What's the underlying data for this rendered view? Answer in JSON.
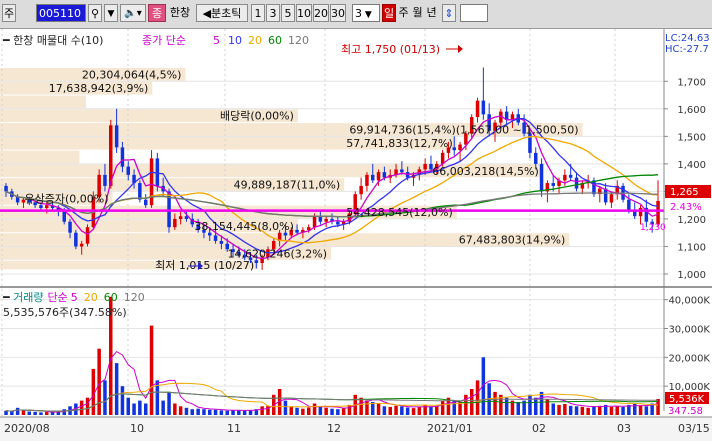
{
  "toolbar": {
    "left_label": "주",
    "stock_code": "005110",
    "stock_name": "한창",
    "tick_label": "분초틱",
    "intervals": [
      "1",
      "3",
      "5",
      "10",
      "20",
      "30"
    ],
    "interval_value": "3",
    "period_buttons": [
      "일",
      "주",
      "월",
      "년"
    ],
    "colors": {
      "bg": "#dcdcdc",
      "code_bg": "#1a1ad6",
      "active_period": "#d00000"
    }
  },
  "price_panel": {
    "title_name": "한창 매물대 수(10)",
    "ma_label": "종가 단순",
    "ma_periods": [
      "5",
      "10",
      "20",
      "60",
      "120"
    ],
    "ma_colors": [
      "#cc00cc",
      "#3333ee",
      "#f0a800",
      "#008800",
      "#777777"
    ],
    "lc_label": "LC:24.63",
    "hc_label": "HC:-27.7",
    "y_ticks": [
      1000,
      1100,
      1200,
      1300,
      1400,
      1500,
      1600,
      1700
    ],
    "y_tick_labels": [
      "1,000",
      "1,100",
      "1,200",
      "1,300",
      "1,400",
      "1,500",
      "1,600",
      "1,700"
    ],
    "ylim": [
      960,
      1810
    ],
    "current_price_label": "1,265",
    "current_pct_label": "2.43%",
    "mark_price_label": "1,230",
    "hline_price": 1230,
    "hline_color": "#ee00ee",
    "volume_profile": [
      {
        "price_lo": 1015,
        "price_hi": 1050,
        "length": 0.39,
        "label": "최저 1,015 (10/27)"
      },
      {
        "price_lo": 1050,
        "price_hi": 1100,
        "length": 0.5,
        "label": "14,620,246(3,2%)"
      },
      {
        "price_lo": 1100,
        "price_hi": 1150,
        "length": 0.86,
        "label": "67,483,803(14,9%)"
      },
      {
        "price_lo": 1150,
        "price_hi": 1200,
        "length": 0.45,
        "label": "38,154,445(8,0%)"
      },
      {
        "price_lo": 1200,
        "price_hi": 1250,
        "length": 0.69,
        "label": "54,428,545(12,0%)"
      },
      {
        "price_lo": 1250,
        "price_hi": 1300,
        "length": 0.17,
        "label": "유상증자(0,00%)"
      },
      {
        "price_lo": 1300,
        "price_hi": 1350,
        "length": 0.52,
        "label": "49,889,187(11,0%)"
      },
      {
        "price_lo": 1350,
        "price_hi": 1400,
        "length": 0.82,
        "label": "66,003,218(14,5%)"
      },
      {
        "price_lo": 1400,
        "price_hi": 1450,
        "length": 0.12,
        "label": ""
      },
      {
        "price_lo": 1450,
        "price_hi": 1500,
        "length": 0.69,
        "label": "57,741,833(12,7%)"
      },
      {
        "price_lo": 1500,
        "price_hi": 1550,
        "length": 0.88,
        "label": "69,914,736(15,4%)(1,567,00 ~ 1,500,50)"
      },
      {
        "price_lo": 1550,
        "price_hi": 1600,
        "length": 0.45,
        "label": "배당락(0,00%)"
      },
      {
        "price_lo": 1600,
        "price_hi": 1650,
        "length": 0.13,
        "label": ""
      },
      {
        "price_lo": 1650,
        "price_hi": 1700,
        "length": 0.23,
        "label": "17,638,942(3,9%)"
      },
      {
        "price_lo": 1700,
        "price_hi": 1750,
        "length": 0.28,
        "label": "20,304,064(4,5%)"
      }
    ],
    "annotations": {
      "high": "최고 1,750 (01/13)",
      "low": "최저 1,015 (10/27)",
      "rights_issue": "유상증자(0,00%)",
      "ex_dividend": "배당락(0,00%)"
    }
  },
  "volume_panel": {
    "title_prefix": "거래량",
    "ma_label": "단순",
    "ma_periods": [
      "5",
      "20",
      "60",
      "120"
    ],
    "ma_colors": [
      "#cc00cc",
      "#f0a800",
      "#008800",
      "#777777"
    ],
    "value_label": "5,535,576주(347.58%)",
    "y_ticks": [
      10000,
      20000,
      30000,
      40000
    ],
    "y_tick_labels": [
      "10,000K",
      "20,000K",
      "30,000K",
      "40,000K"
    ],
    "ylim": [
      0,
      43000
    ],
    "current_volume_label": "5,536K",
    "current_sub_label": "347.58"
  },
  "x_axis": {
    "tick_labels": [
      "2020/08",
      "10",
      "11",
      "12",
      "2021/01",
      "02",
      "03",
      "03/15"
    ]
  },
  "chart_data": {
    "type": "candlestick",
    "title": "한창 매물대 수(10)",
    "x": [
      "2020/08",
      "10",
      "11",
      "12",
      "2021/01",
      "02",
      "03",
      "03/15"
    ],
    "ylim": [
      960,
      1810
    ],
    "volume_ylim": [
      0,
      43000
    ],
    "candles": [
      [
        1320,
        1330,
        1280,
        1300,
        1500
      ],
      [
        1300,
        1310,
        1270,
        1280,
        1200
      ],
      [
        1280,
        1290,
        1250,
        1260,
        2500
      ],
      [
        1260,
        1280,
        1240,
        1270,
        1800
      ],
      [
        1270,
        1280,
        1250,
        1260,
        1200
      ],
      [
        1260,
        1270,
        1240,
        1250,
        1100
      ],
      [
        1250,
        1260,
        1230,
        1240,
        900
      ],
      [
        1240,
        1260,
        1220,
        1250,
        1000
      ],
      [
        1250,
        1260,
        1230,
        1240,
        900
      ],
      [
        1240,
        1250,
        1210,
        1230,
        1300
      ],
      [
        1230,
        1240,
        1180,
        1190,
        2000
      ],
      [
        1190,
        1200,
        1130,
        1150,
        3000
      ],
      [
        1150,
        1160,
        1090,
        1100,
        4000
      ],
      [
        1100,
        1120,
        1070,
        1110,
        5000
      ],
      [
        1110,
        1180,
        1100,
        1170,
        6000
      ],
      [
        1170,
        1300,
        1160,
        1280,
        16000
      ],
      [
        1280,
        1380,
        1260,
        1360,
        23000
      ],
      [
        1360,
        1400,
        1300,
        1320,
        12000
      ],
      [
        1320,
        1560,
        1310,
        1540,
        41000
      ],
      [
        1540,
        1600,
        1440,
        1460,
        18000
      ],
      [
        1460,
        1480,
        1370,
        1390,
        10000
      ],
      [
        1390,
        1410,
        1340,
        1360,
        6000
      ],
      [
        1360,
        1380,
        1310,
        1330,
        4000
      ],
      [
        1330,
        1340,
        1260,
        1270,
        5000
      ],
      [
        1270,
        1290,
        1240,
        1250,
        4000
      ],
      [
        1250,
        1450,
        1240,
        1420,
        31000
      ],
      [
        1420,
        1440,
        1300,
        1320,
        12000
      ],
      [
        1320,
        1350,
        1280,
        1300,
        5000
      ],
      [
        1300,
        1310,
        1150,
        1170,
        8000
      ],
      [
        1170,
        1220,
        1160,
        1200,
        4000
      ],
      [
        1200,
        1230,
        1180,
        1210,
        3000
      ],
      [
        1210,
        1230,
        1190,
        1200,
        2500
      ],
      [
        1200,
        1220,
        1170,
        1180,
        2000
      ],
      [
        1180,
        1200,
        1150,
        1160,
        2200
      ],
      [
        1160,
        1180,
        1130,
        1150,
        2000
      ],
      [
        1150,
        1170,
        1120,
        1140,
        1800
      ],
      [
        1140,
        1160,
        1110,
        1120,
        1800
      ],
      [
        1120,
        1140,
        1090,
        1110,
        1600
      ],
      [
        1110,
        1130,
        1080,
        1090,
        1500
      ],
      [
        1090,
        1110,
        1060,
        1080,
        1700
      ],
      [
        1080,
        1100,
        1060,
        1070,
        1600
      ],
      [
        1070,
        1090,
        1050,
        1060,
        1500
      ],
      [
        1060,
        1080,
        1040,
        1050,
        1700
      ],
      [
        1050,
        1070,
        1020,
        1040,
        2000
      ],
      [
        1040,
        1070,
        1015,
        1060,
        3000
      ],
      [
        1060,
        1100,
        1050,
        1090,
        3200
      ],
      [
        1090,
        1130,
        1080,
        1120,
        7000
      ],
      [
        1120,
        1160,
        1100,
        1150,
        9000
      ],
      [
        1150,
        1180,
        1120,
        1140,
        5000
      ],
      [
        1140,
        1170,
        1130,
        1160,
        3000
      ],
      [
        1160,
        1180,
        1140,
        1150,
        2500
      ],
      [
        1150,
        1170,
        1130,
        1160,
        2200
      ],
      [
        1160,
        1180,
        1150,
        1170,
        2600
      ],
      [
        1170,
        1220,
        1160,
        1210,
        4000
      ],
      [
        1210,
        1230,
        1180,
        1190,
        3000
      ],
      [
        1190,
        1210,
        1170,
        1200,
        2500
      ],
      [
        1200,
        1220,
        1180,
        1190,
        2200
      ],
      [
        1190,
        1210,
        1170,
        1180,
        2000
      ],
      [
        1180,
        1200,
        1160,
        1190,
        2300
      ],
      [
        1190,
        1230,
        1180,
        1220,
        3500
      ],
      [
        1220,
        1300,
        1210,
        1290,
        7000
      ],
      [
        1290,
        1350,
        1270,
        1320,
        6000
      ],
      [
        1320,
        1370,
        1300,
        1360,
        5000
      ],
      [
        1360,
        1400,
        1330,
        1340,
        4500
      ],
      [
        1340,
        1380,
        1320,
        1370,
        4000
      ],
      [
        1370,
        1390,
        1340,
        1350,
        3000
      ],
      [
        1350,
        1380,
        1330,
        1360,
        2800
      ],
      [
        1360,
        1400,
        1350,
        1380,
        3200
      ],
      [
        1380,
        1410,
        1360,
        1370,
        3000
      ],
      [
        1370,
        1390,
        1340,
        1350,
        2600
      ],
      [
        1350,
        1370,
        1320,
        1360,
        2400
      ],
      [
        1360,
        1390,
        1340,
        1380,
        2800
      ],
      [
        1380,
        1420,
        1360,
        1400,
        3500
      ],
      [
        1400,
        1430,
        1370,
        1380,
        3000
      ],
      [
        1380,
        1410,
        1360,
        1400,
        3200
      ],
      [
        1400,
        1450,
        1390,
        1440,
        5000
      ],
      [
        1440,
        1480,
        1420,
        1460,
        6000
      ],
      [
        1460,
        1500,
        1430,
        1450,
        5000
      ],
      [
        1450,
        1480,
        1410,
        1470,
        4500
      ],
      [
        1470,
        1520,
        1450,
        1510,
        7000
      ],
      [
        1510,
        1580,
        1490,
        1570,
        9000
      ],
      [
        1570,
        1640,
        1550,
        1630,
        12000
      ],
      [
        1630,
        1750,
        1560,
        1580,
        20000
      ],
      [
        1580,
        1620,
        1500,
        1520,
        11000
      ],
      [
        1520,
        1560,
        1480,
        1550,
        8000
      ],
      [
        1550,
        1600,
        1530,
        1590,
        7000
      ],
      [
        1590,
        1610,
        1540,
        1560,
        6000
      ],
      [
        1560,
        1590,
        1530,
        1580,
        5000
      ],
      [
        1580,
        1600,
        1540,
        1550,
        4500
      ],
      [
        1550,
        1580,
        1500,
        1510,
        5000
      ],
      [
        1510,
        1530,
        1420,
        1440,
        7000
      ],
      [
        1440,
        1460,
        1380,
        1400,
        6000
      ],
      [
        1400,
        1420,
        1280,
        1300,
        8000
      ],
      [
        1300,
        1340,
        1260,
        1330,
        5500
      ],
      [
        1330,
        1360,
        1300,
        1320,
        4000
      ],
      [
        1320,
        1350,
        1290,
        1340,
        3500
      ],
      [
        1340,
        1380,
        1320,
        1360,
        3800
      ],
      [
        1360,
        1400,
        1340,
        1350,
        3200
      ],
      [
        1350,
        1370,
        1300,
        1310,
        3000
      ],
      [
        1310,
        1340,
        1290,
        1330,
        2800
      ],
      [
        1330,
        1360,
        1310,
        1340,
        2500
      ],
      [
        1340,
        1350,
        1280,
        1290,
        3000
      ],
      [
        1290,
        1320,
        1260,
        1310,
        3200
      ],
      [
        1310,
        1330,
        1250,
        1260,
        3500
      ],
      [
        1260,
        1300,
        1240,
        1290,
        2800
      ],
      [
        1290,
        1340,
        1270,
        1320,
        3000
      ],
      [
        1320,
        1330,
        1260,
        1270,
        2800
      ],
      [
        1270,
        1290,
        1220,
        1230,
        3500
      ],
      [
        1230,
        1260,
        1200,
        1210,
        3800
      ],
      [
        1210,
        1250,
        1180,
        1240,
        3200
      ],
      [
        1240,
        1270,
        1170,
        1190,
        3000
      ],
      [
        1190,
        1200,
        1150,
        1180,
        4000
      ],
      [
        1180,
        1340,
        1170,
        1265,
        5536
      ]
    ]
  }
}
